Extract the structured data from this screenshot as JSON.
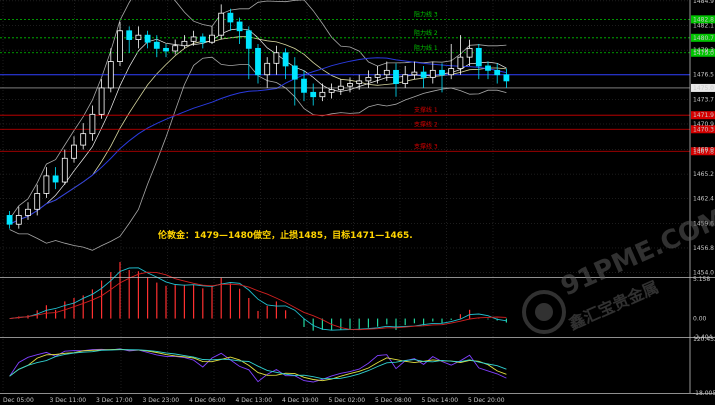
{
  "chart_data": {
    "type": "candlestick",
    "annotation": "伦敦金：1479—1480做空，止损1485，目标1471—1465.",
    "watermark": {
      "brand": "91PME.COM",
      "subtitle": "鑫汇宝贵金属"
    },
    "x_tick_labels": [
      "Dec 05:00",
      "3 Dec 11:00",
      "3 Dec 17:00",
      "3 Dec 23:00",
      "4 Dec 06:00",
      "4 Dec 13:00",
      "4 Dec 19:00",
      "5 Dec 02:00",
      "5 Dec 08:00",
      "5 Dec 14:00",
      "5 Dec 20:00"
    ],
    "main_panel": {
      "ylim": [
        1453.5,
        1485.0
      ],
      "y_ticks": [
        1484.9,
        1482.1,
        1479.3,
        1476.5,
        1473.7,
        1470.9,
        1468.0,
        1465.2,
        1462.4,
        1459.6,
        1456.8,
        1454.0
      ],
      "last_price": 1475.0,
      "levels": [
        {
          "label": "阻力线 3",
          "value": 1482.8,
          "kind": "resistance"
        },
        {
          "label": "阻力线 2",
          "value": 1480.7,
          "kind": "resistance"
        },
        {
          "label": "阻力线 1",
          "value": 1479.0,
          "kind": "resistance"
        },
        {
          "label": "支撑线 1",
          "value": 1471.9,
          "kind": "support"
        },
        {
          "label": "支撑线 2",
          "value": 1470.3,
          "kind": "support"
        },
        {
          "label": "支撑线 3",
          "value": 1467.8,
          "kind": "support"
        }
      ],
      "candles": [
        [
          1460.5,
          1459.5,
          1461,
          1459
        ],
        [
          1459.5,
          1460.5,
          1461.5,
          1459
        ],
        [
          1460.5,
          1461.2,
          1462,
          1460
        ],
        [
          1461.2,
          1463,
          1464,
          1460.5
        ],
        [
          1463,
          1465,
          1466,
          1462.5
        ],
        [
          1465,
          1464.3,
          1466,
          1463.5
        ],
        [
          1464.3,
          1467,
          1468,
          1464
        ],
        [
          1467,
          1468.5,
          1469.5,
          1466.5
        ],
        [
          1468.5,
          1469.8,
          1471,
          1468
        ],
        [
          1469.8,
          1472,
          1473,
          1469
        ],
        [
          1472,
          1475,
          1476,
          1471.5
        ],
        [
          1475,
          1478,
          1479.5,
          1474.5
        ],
        [
          1478,
          1481.5,
          1482.5,
          1477.5
        ],
        [
          1481.5,
          1480.5,
          1482,
          1479
        ],
        [
          1480.5,
          1481,
          1482,
          1479.5
        ],
        [
          1481,
          1480.2,
          1481.5,
          1479.5
        ],
        [
          1480.2,
          1479.5,
          1481,
          1478.5
        ],
        [
          1479.5,
          1479.2,
          1480,
          1478.5
        ],
        [
          1479.2,
          1479.8,
          1480.5,
          1478.8
        ],
        [
          1479.8,
          1480.3,
          1481,
          1479.5
        ],
        [
          1480.3,
          1480.8,
          1481.5,
          1479.8
        ],
        [
          1480.8,
          1480.2,
          1481.2,
          1479.5
        ],
        [
          1480.2,
          1481,
          1482,
          1480
        ],
        [
          1481,
          1483.5,
          1484.5,
          1480.5
        ],
        [
          1483.5,
          1482.5,
          1484,
          1481.5
        ],
        [
          1482.5,
          1481.5,
          1483,
          1480
        ],
        [
          1481.5,
          1479.5,
          1482,
          1476
        ],
        [
          1479.5,
          1476.5,
          1480,
          1475.5
        ],
        [
          1476.5,
          1477.8,
          1478.5,
          1475
        ],
        [
          1477.8,
          1479,
          1479.8,
          1476.5
        ],
        [
          1479,
          1477.5,
          1479.5,
          1476
        ],
        [
          1477.5,
          1476,
          1478.5,
          1473
        ],
        [
          1476,
          1474.5,
          1477,
          1473.5
        ],
        [
          1474.5,
          1474,
          1475.5,
          1473
        ],
        [
          1474,
          1474.5,
          1475.5,
          1473.5
        ],
        [
          1474.5,
          1474.8,
          1475.5,
          1473.8
        ],
        [
          1474.8,
          1475.2,
          1476,
          1474.2
        ],
        [
          1475.2,
          1475.5,
          1476.2,
          1474.5
        ],
        [
          1475.5,
          1475.8,
          1476.5,
          1474.8
        ],
        [
          1475.8,
          1476.2,
          1477,
          1475
        ],
        [
          1476.2,
          1476.5,
          1477.5,
          1475.5
        ],
        [
          1476.5,
          1477,
          1478,
          1475.8
        ],
        [
          1477,
          1475.5,
          1477.8,
          1474
        ],
        [
          1475.5,
          1476.5,
          1477.5,
          1475
        ],
        [
          1476.5,
          1476.8,
          1478,
          1476
        ],
        [
          1476.8,
          1476.2,
          1477.5,
          1475
        ],
        [
          1476.2,
          1477,
          1478,
          1475.5
        ],
        [
          1477,
          1476.5,
          1477.8,
          1474.5
        ],
        [
          1476.5,
          1477.2,
          1480,
          1476
        ],
        [
          1477.2,
          1478.5,
          1481,
          1476.5
        ],
        [
          1478.5,
          1479.5,
          1480.5,
          1477.5
        ],
        [
          1479.5,
          1477.5,
          1480,
          1476
        ],
        [
          1477.5,
          1477,
          1478,
          1476
        ],
        [
          1477,
          1476.5,
          1477.8,
          1475.5
        ],
        [
          1476.5,
          1475.8,
          1477.2,
          1475
        ]
      ]
    },
    "macd_panel": {
      "ylim": [
        -2.404,
        5.158
      ],
      "y_ticks": [
        5.158,
        0.0,
        -2.404
      ]
    },
    "stoch_panel": {
      "ylim": [
        -18.0,
        120.0
      ],
      "y_ticks": [
        120.432,
        -18.005
      ]
    }
  },
  "colors": {
    "candle_up": "#ffffff",
    "candle_down": "#00e5ff",
    "resistance": "#00c400",
    "support": "#d40000",
    "last_price_badge": "#e8e8e8",
    "grid": "#3a3a3a"
  }
}
